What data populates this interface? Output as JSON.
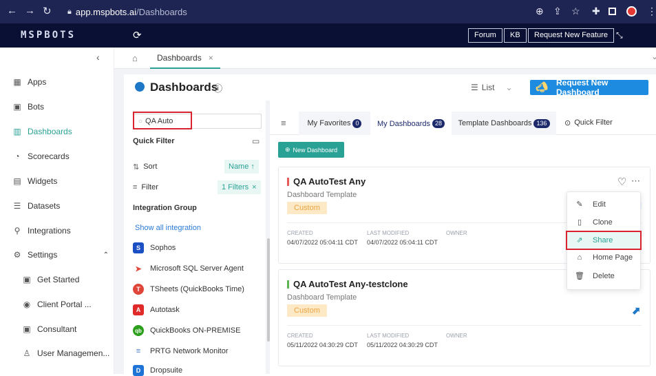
{
  "browser": {
    "url_host": "app.mspbots.ai",
    "url_path": "/Dashboards"
  },
  "header": {
    "logo": "MSPBOTS",
    "buttons": [
      "Forum",
      "KB",
      "Request New Feature"
    ]
  },
  "sidebar": {
    "items": [
      {
        "label": "Apps",
        "icon": "apps-icon"
      },
      {
        "label": "Bots",
        "icon": "bots-icon"
      },
      {
        "label": "Dashboards",
        "icon": "dashboards-icon"
      },
      {
        "label": "Scorecards",
        "icon": "scorecards-icon"
      },
      {
        "label": "Widgets",
        "icon": "widgets-icon"
      },
      {
        "label": "Datasets",
        "icon": "datasets-icon"
      },
      {
        "label": "Integrations",
        "icon": "integrations-icon"
      },
      {
        "label": "Settings",
        "icon": "settings-icon"
      },
      {
        "label": "Get Started",
        "icon": "get-started-icon"
      },
      {
        "label": "Client Portal ...",
        "icon": "client-portal-icon"
      },
      {
        "label": "Consultant",
        "icon": "consultant-icon"
      },
      {
        "label": "User Managemen...",
        "icon": "user-management-icon"
      }
    ],
    "active": "Dashboards"
  },
  "tabs": {
    "open_tab": "Dashboards"
  },
  "page": {
    "title": "Dashboards",
    "view_mode": "List",
    "request_button": "Request New Dashboard"
  },
  "filter_panel": {
    "search_value": "QA Auto",
    "quick_filter_title": "Quick Filter",
    "sort_label": "Sort",
    "sort_value": "Name ↑",
    "filter_label": "Filter",
    "filter_value": "1 Filters",
    "integration_group_title": "Integration Group",
    "show_all": "Show all integration",
    "integrations": [
      {
        "name": "Sophos",
        "color": "#1b4fc4",
        "glyph": "S"
      },
      {
        "name": "Microsoft SQL Server Agent",
        "color": "#e4453a",
        "glyph": "➤"
      },
      {
        "name": "TSheets (QuickBooks Time)",
        "color": "#e0453a",
        "glyph": "T"
      },
      {
        "name": "Autotask",
        "color": "#e02a2a",
        "glyph": "A"
      },
      {
        "name": "QuickBooks ON-PREMISE",
        "color": "#2ca01c",
        "glyph": "qb"
      },
      {
        "name": "PRTG Network Monitor",
        "color": "#4a7cc8",
        "glyph": "≡"
      },
      {
        "name": "Dropsuite",
        "color": "#1e73d6",
        "glyph": "D"
      }
    ]
  },
  "dashboard_tabs": [
    {
      "label": "My Favorites",
      "count": "0"
    },
    {
      "label": "My Dashboards",
      "count": "28"
    },
    {
      "label": "Template Dashboards",
      "count": "136"
    }
  ],
  "quick_filter_tab": "Quick Filter",
  "new_dashboard_button": "New Dashboard",
  "cards": [
    {
      "title": "QA AutoTest Any",
      "subtitle": "Dashboard Template",
      "tag": "Custom",
      "created_label": "CREATED",
      "created": "04/07/2022 05:04:11 CDT",
      "modified_label": "LAST MODIFIED",
      "modified": "04/07/2022 05:04:11 CDT",
      "owner_label": "OWNER",
      "accent": "#e85a5a"
    },
    {
      "title": "QA AutoTest Any-testclone",
      "subtitle": "Dashboard Template",
      "tag": "Custom",
      "created_label": "CREATED",
      "created": "05/11/2022 04:30:29 CDT",
      "modified_label": "LAST MODIFIED",
      "modified": "05/11/2022 04:30:29 CDT",
      "owner_label": "OWNER",
      "accent": "#5ab552"
    }
  ],
  "context_menu": [
    "Edit",
    "Clone",
    "Share",
    "Home Page",
    "Delete"
  ],
  "colors": {
    "accent": "#2aa195",
    "brand_dark": "#0a1033",
    "highlight_box": "#d9232e"
  }
}
